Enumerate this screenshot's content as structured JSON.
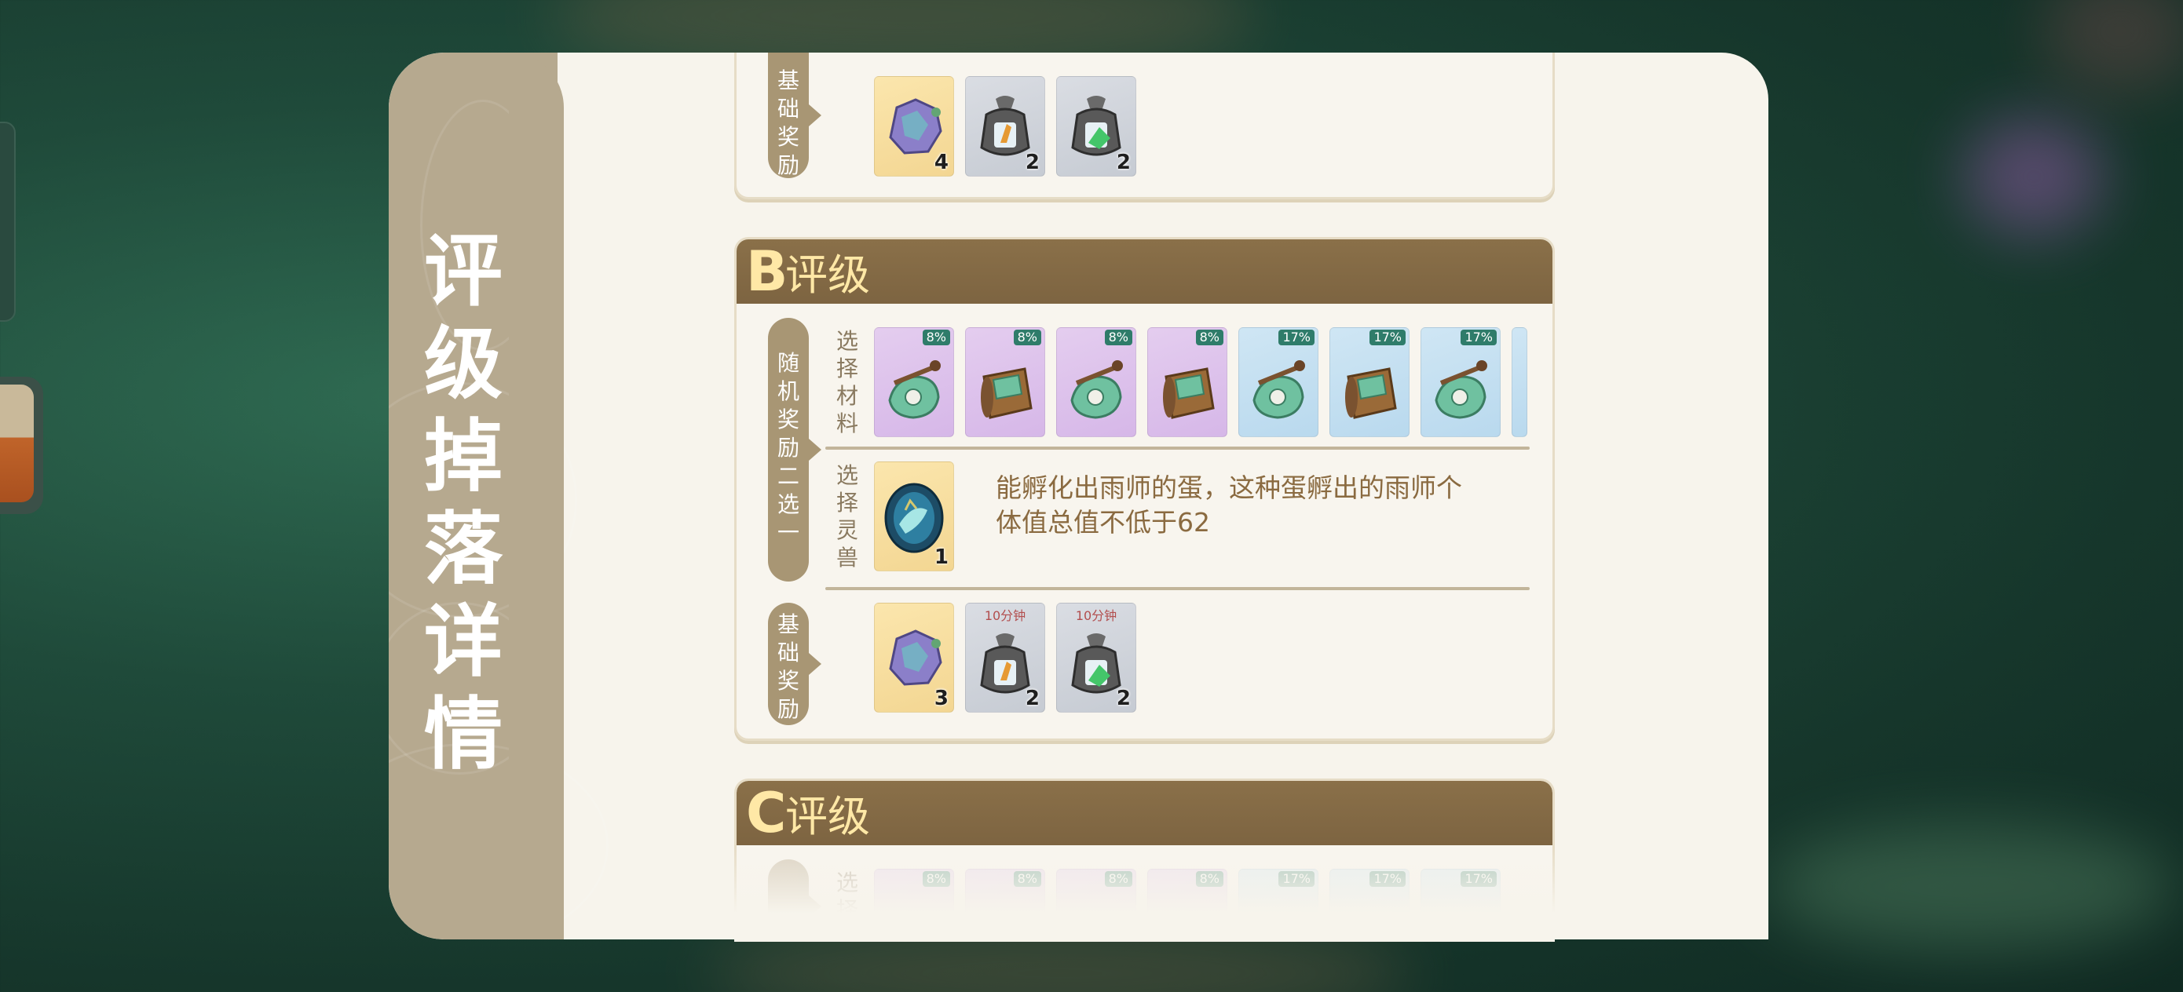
{
  "panel": {
    "title_chars": [
      "评",
      "级",
      "掉",
      "落",
      "详",
      "情"
    ]
  },
  "top_card": {
    "base_label_chars": [
      "基",
      "础",
      "奖",
      "励"
    ],
    "items": [
      {
        "icon": "purple-spirit-fragment-icon",
        "count": "4"
      },
      {
        "icon": "orange-crystal-bag-icon",
        "count": "2"
      },
      {
        "icon": "green-crystal-bag-icon",
        "count": "2"
      }
    ]
  },
  "b_card": {
    "grade_letter": "B",
    "grade_suffix": "评级",
    "random_label_chars": [
      "随",
      "机",
      "奖",
      "励",
      "二",
      "选",
      "一"
    ],
    "material_label_chars": [
      "选",
      "择",
      "材",
      "料"
    ],
    "materials": [
      {
        "icon": "green-jade-pendant-icon",
        "badge": "8%",
        "tone": "purple"
      },
      {
        "icon": "wooden-bracer-icon",
        "badge": "8%",
        "tone": "purple"
      },
      {
        "icon": "green-jade-pendant-icon",
        "badge": "8%",
        "tone": "purple"
      },
      {
        "icon": "wooden-bracer-icon",
        "badge": "8%",
        "tone": "purple"
      },
      {
        "icon": "green-jade-pendant-icon",
        "badge": "17%",
        "tone": "blue"
      },
      {
        "icon": "wooden-bracer-icon",
        "badge": "17%",
        "tone": "blue"
      },
      {
        "icon": "green-jade-pendant-icon",
        "badge": "17%",
        "tone": "blue"
      }
    ],
    "beast_label_chars": [
      "选",
      "择",
      "灵",
      "兽"
    ],
    "beast_egg": {
      "icon": "rain-master-egg-icon",
      "count": "1"
    },
    "beast_desc_line1": "能孵化出雨师的蛋，这种蛋孵出的雨师个",
    "beast_desc_line2": "体值总值不低于62",
    "base_label_chars": [
      "基",
      "础",
      "奖",
      "励"
    ],
    "base_items": [
      {
        "icon": "purple-spirit-fragment-icon",
        "count": "3",
        "timer": ""
      },
      {
        "icon": "orange-crystal-bag-icon",
        "count": "2",
        "timer": "10分钟"
      },
      {
        "icon": "green-crystal-bag-icon",
        "count": "2",
        "timer": "10分钟"
      }
    ]
  },
  "c_card": {
    "grade_letter": "C",
    "grade_suffix": "评级",
    "material_label_chars": [
      "选",
      "择"
    ],
    "badges": [
      "8%",
      "8%",
      "8%",
      "8%",
      "17%",
      "17%",
      "17%"
    ]
  },
  "colors": {
    "panel_bg": "#f7f4ec",
    "side_strip": "#b6a98f",
    "card_header": "#7d6441",
    "grade_text": "#ffe8a6",
    "badge": "#2f7c6a"
  }
}
